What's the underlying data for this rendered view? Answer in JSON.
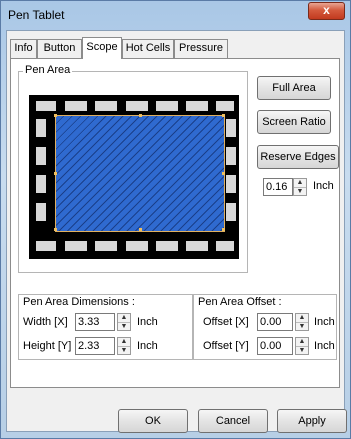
{
  "window": {
    "title": "Pen Tablet",
    "close_symbol": "x"
  },
  "tabs": [
    {
      "label": "Info"
    },
    {
      "label": "Button"
    },
    {
      "label": "Scope"
    },
    {
      "label": "Hot Cells"
    },
    {
      "label": "Pressure"
    }
  ],
  "active_tab": "Scope",
  "pen_area": {
    "group_label": "Pen Area",
    "full_area_label": "Full Area",
    "screen_ratio_label": "Screen Ratio",
    "reserve_edges_label": "Reserve Edges",
    "reserve_value": "0.16",
    "reserve_unit": "Inch",
    "area_fill_color": "#2f6ad0"
  },
  "dimensions": {
    "group_label": "Pen Area Dimensions :",
    "width_label": "Width [X]",
    "width_value": "3.33",
    "height_label": "Height [Y]",
    "height_value": "2.33",
    "unit": "Inch"
  },
  "offset": {
    "group_label": "Pen Area Offset :",
    "x_label": "Offset [X]",
    "x_value": "0.00",
    "y_label": "Offset [Y]",
    "y_value": "0.00",
    "unit": "Inch"
  },
  "footer": {
    "ok": "OK",
    "cancel": "Cancel",
    "apply": "Apply"
  }
}
